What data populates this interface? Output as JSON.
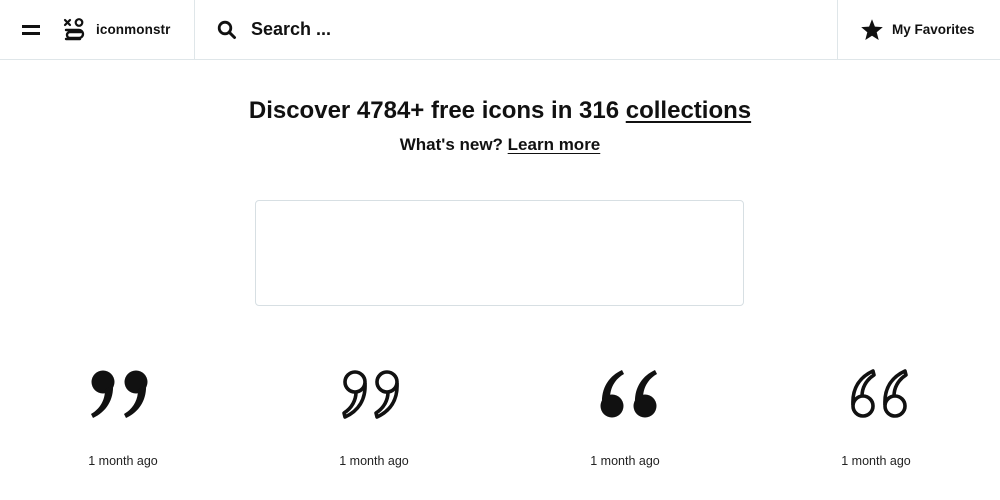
{
  "header": {
    "brand_name": "iconmonstr",
    "search_placeholder": "Search ...",
    "favorites_label": "My Favorites"
  },
  "hero": {
    "title_prefix": "Discover 4784+ free icons in 316 ",
    "title_link": "collections",
    "subtitle_prefix": "What's new? ",
    "subtitle_link": "Learn more"
  },
  "icons": [
    {
      "icon": "quote-right-filled-icon",
      "time": "1 month ago"
    },
    {
      "icon": "quote-right-outline-icon",
      "time": "1 month ago"
    },
    {
      "icon": "quote-left-filled-icon",
      "time": "1 month ago"
    },
    {
      "icon": "quote-left-outline-icon",
      "time": "1 month ago"
    }
  ]
}
